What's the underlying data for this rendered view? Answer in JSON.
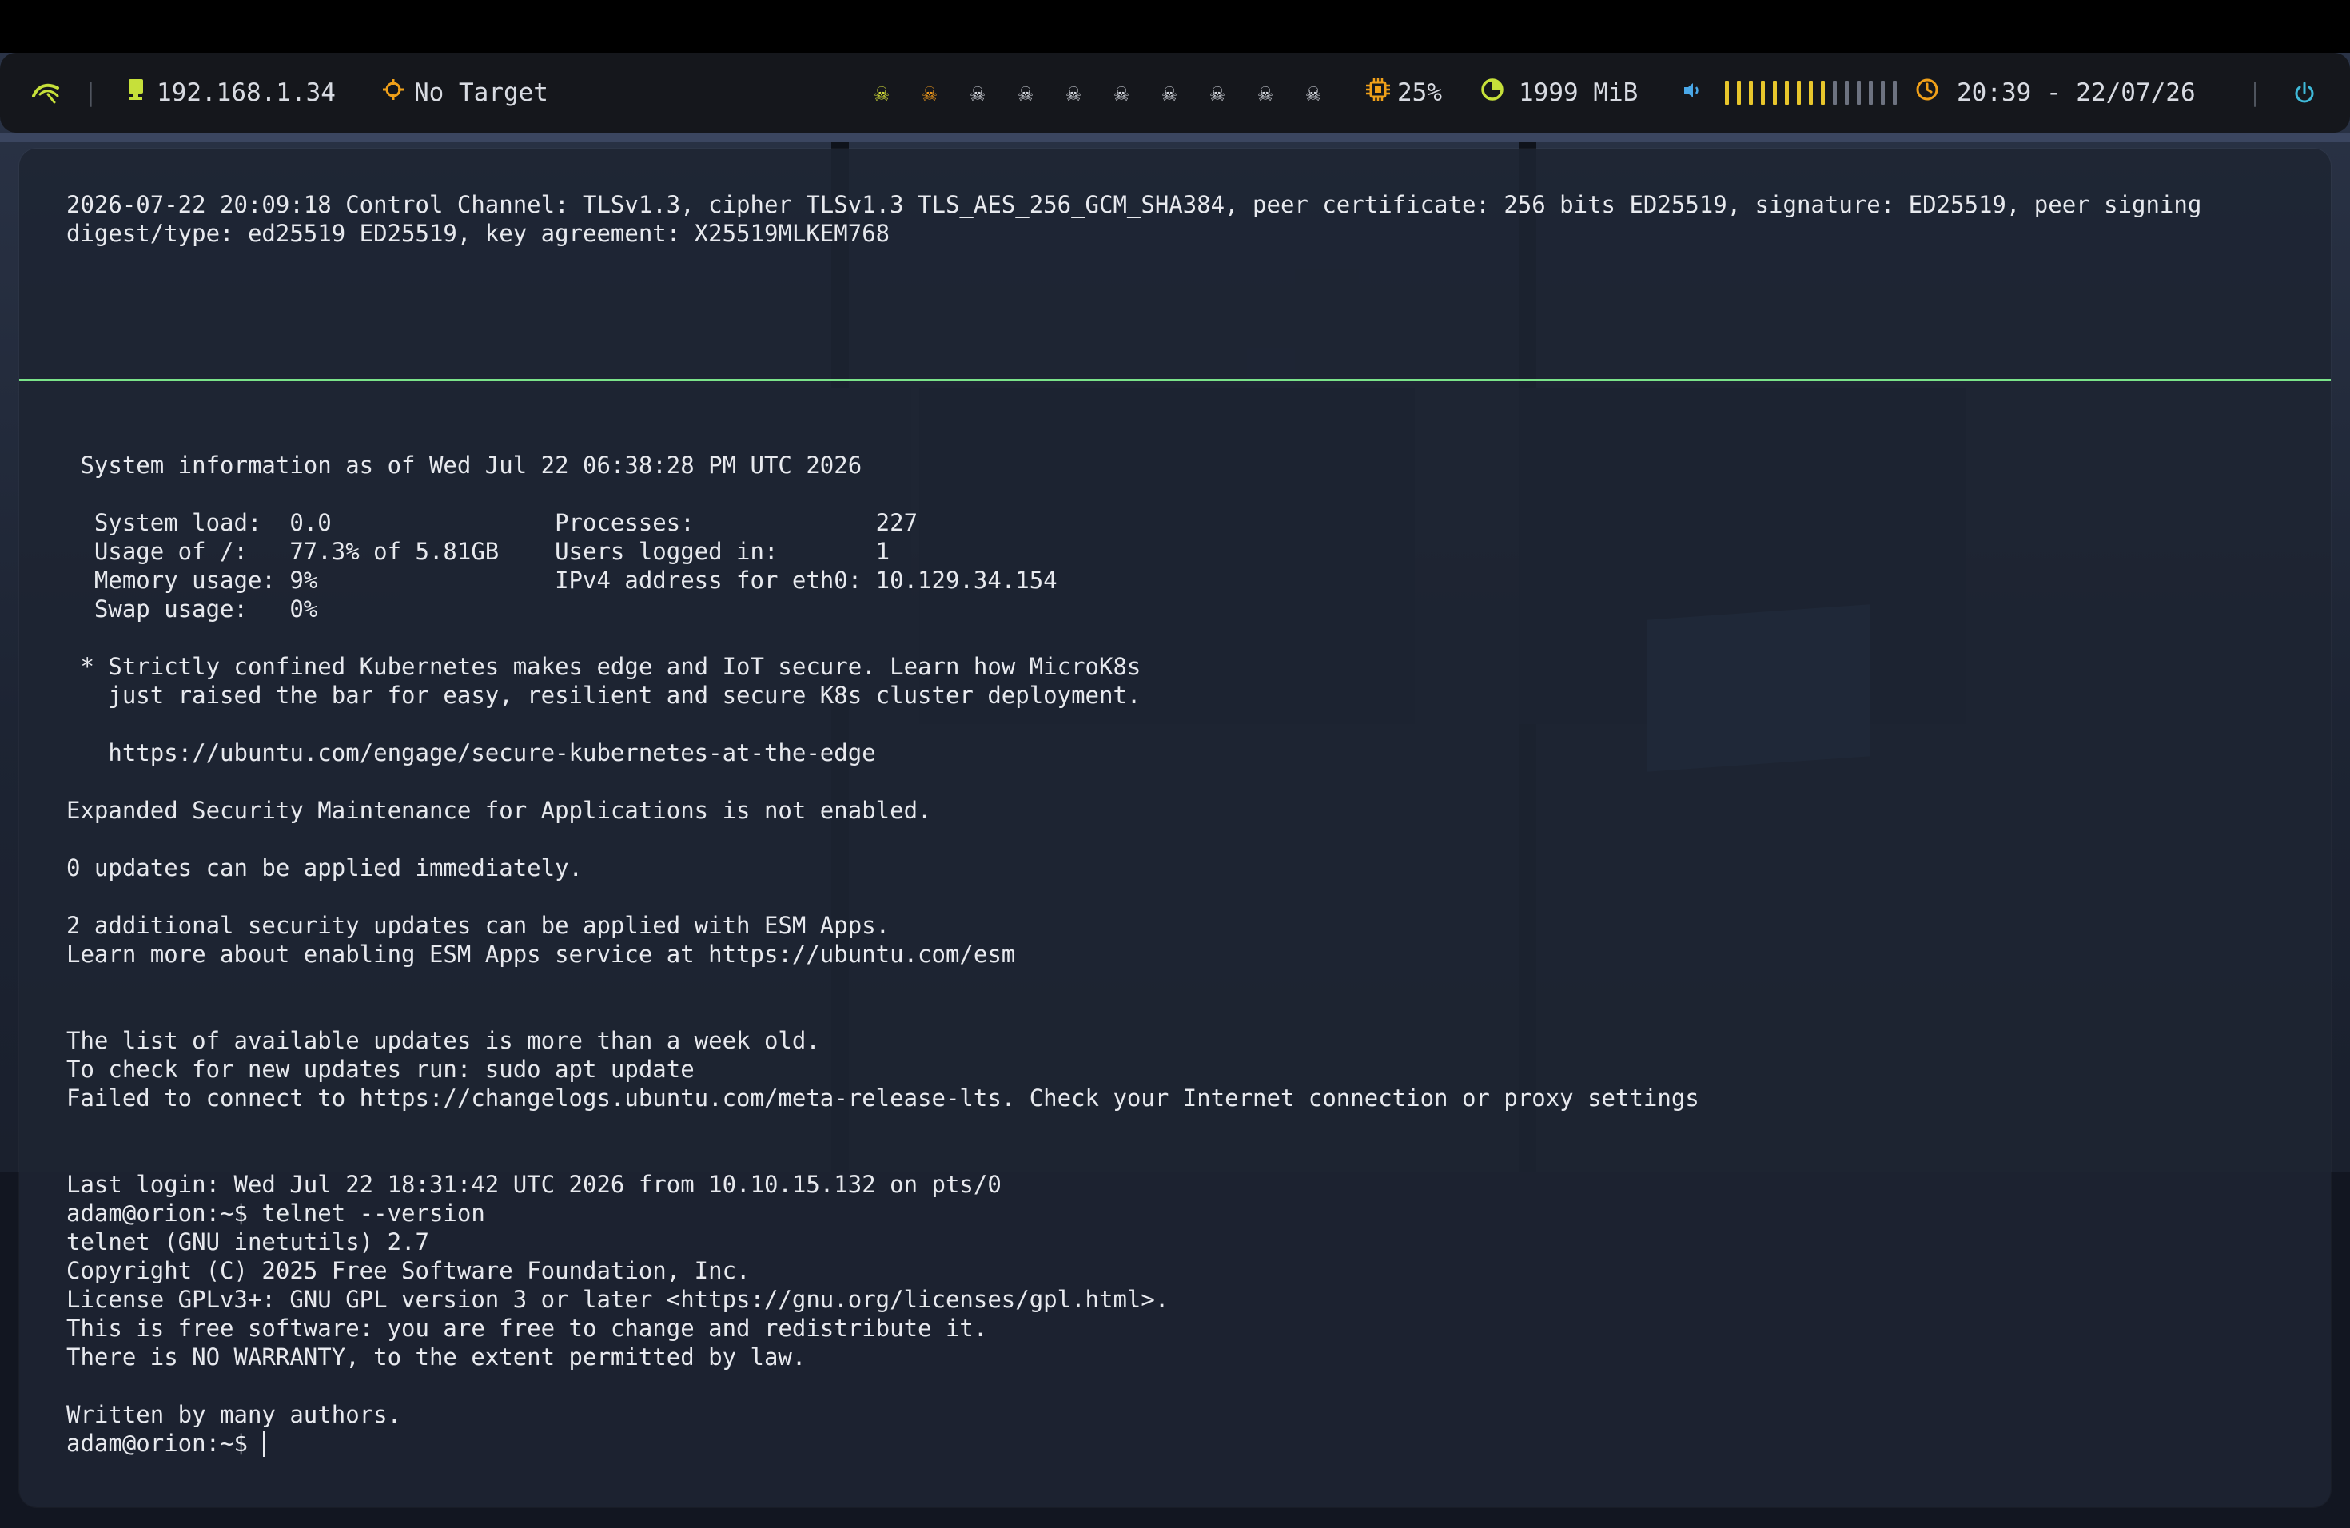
{
  "topbar": {
    "ip": "192.168.1.34",
    "target": "No Target",
    "cpu": "25%",
    "memory": "1999 MiB",
    "volume_level": 0.6,
    "clock": "20:39 - 22/07/26",
    "workspaces_active": 2,
    "workspaces_total": 10,
    "colors": {
      "bar_bg": "#15171c",
      "ip_icon": "#c6e03a",
      "target_icon": "#f0a019",
      "skull_active_1": "#d7e23a",
      "skull_active_2": "#f39b1c",
      "skull_inactive": "#d8dbe2",
      "cpu_icon": "#f0a019",
      "mem_icon": "#c6e03a",
      "volume_icon": "#4aa8e8",
      "volume_on": "#e8c62c",
      "volume_off": "#6d7280",
      "clock_icon": "#f0a019",
      "power_icon": "#3fb9d8"
    },
    "icons": [
      "logo-icon",
      "monitor-icon",
      "crosshair-icon",
      "skull-icon",
      "cpu-icon",
      "memory-icon",
      "volume-icon",
      "clock-icon",
      "power-icon"
    ]
  },
  "terminal": {
    "lines": [
      "2026-07-22 20:09:18 Control Channel: TLSv1.3, cipher TLSv1.3 TLS_AES_256_GCM_SHA384, peer certificate: 256 bits ED25519, signature: ED25519, peer signing",
      "digest/type: ed25519 ED25519, key agreement: X25519MLKEM768",
      " System information as of Wed Jul 22 06:38:28 PM UTC 2026",
      "  System load:  0.0                Processes:             227",
      "  Usage of /:   77.3% of 5.81GB    Users logged in:       1",
      "  Memory usage: 9%                 IPv4 address for eth0: 10.129.34.154",
      "  Swap usage:   0%",
      " * Strictly confined Kubernetes makes edge and IoT secure. Learn how MicroK8s",
      "   just raised the bar for easy, resilient and secure K8s cluster deployment.",
      "   https://ubuntu.com/engage/secure-kubernetes-at-the-edge",
      "Expanded Security Maintenance for Applications is not enabled.",
      "0 updates can be applied immediately.",
      "2 additional security updates can be applied with ESM Apps.",
      "Learn more about enabling ESM Apps service at https://ubuntu.com/esm",
      "The list of available updates is more than a week old.",
      "To check for new updates run: sudo apt update",
      "Failed to connect to https://changelogs.ubuntu.com/meta-release-lts. Check your Internet connection or proxy settings",
      "Last login: Wed Jul 22 18:31:42 UTC 2026 from 10.10.15.132 on pts/0",
      "adam@orion:~$ telnet --version",
      "telnet (GNU inetutils) 2.7",
      "Copyright (C) 2025 Free Software Foundation, Inc.",
      "License GPLv3+: GNU GPL version 3 or later <https://gnu.org/licenses/gpl.html>.",
      "This is free software: you are free to change and redistribute it.",
      "There is NO WARRANTY, to the extent permitted by law.",
      "Written by many authors.",
      "adam@orion:~$ "
    ],
    "colors": {
      "text": "#e7e9ee",
      "divider": "#7be38a"
    }
  }
}
